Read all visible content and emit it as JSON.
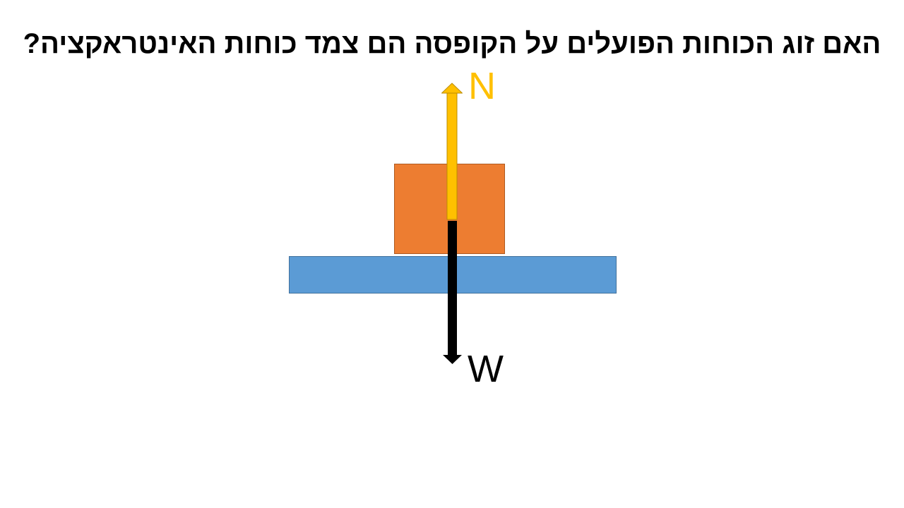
{
  "slide": {
    "title": "האם זוג הכוחות הפועלים על הקופסה הם צמד כוחות האינטראקציה?"
  },
  "diagram": {
    "forces": {
      "normal": {
        "label": "N",
        "color": "#FFC000",
        "direction": "up"
      },
      "weight": {
        "label": "W",
        "color": "#000000",
        "direction": "down"
      }
    },
    "colors": {
      "box": "#ED7D31",
      "table": "#5B9BD5"
    }
  }
}
